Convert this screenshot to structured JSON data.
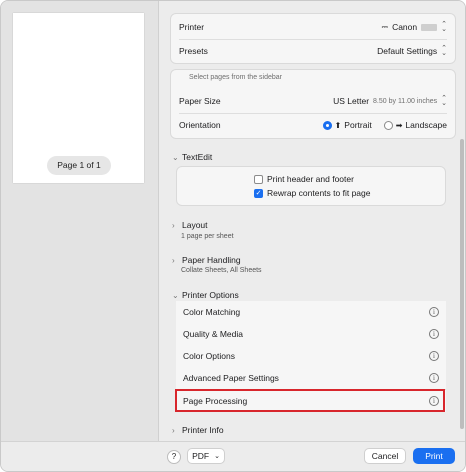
{
  "preview": {
    "page_label": "Page 1 of 1"
  },
  "printer": {
    "label": "Printer",
    "value": "Canon"
  },
  "presets": {
    "label": "Presets",
    "value": "Default Settings"
  },
  "hint": "Select pages from the sidebar",
  "paper_size": {
    "label": "Paper Size",
    "value": "US Letter",
    "detail": "8.50 by 11.00 inches"
  },
  "orientation": {
    "label": "Orientation",
    "portrait": "Portrait",
    "landscape": "Landscape",
    "selected": "Portrait"
  },
  "textedit": {
    "title": "TextEdit",
    "print_header": {
      "label": "Print header and footer",
      "checked": false
    },
    "rewrap": {
      "label": "Rewrap contents to fit page",
      "checked": true
    }
  },
  "layout": {
    "title": "Layout",
    "subtitle": "1 page per sheet"
  },
  "paper_handling": {
    "title": "Paper Handling",
    "subtitle": "Collate Sheets, All Sheets"
  },
  "printer_options": {
    "title": "Printer Options",
    "items": [
      {
        "label": "Color Matching"
      },
      {
        "label": "Quality & Media"
      },
      {
        "label": "Color Options"
      },
      {
        "label": "Advanced Paper Settings"
      },
      {
        "label": "Page Processing"
      }
    ]
  },
  "printer_info": {
    "title": "Printer Info"
  },
  "footer": {
    "help": "?",
    "pdf": "PDF",
    "cancel": "Cancel",
    "print": "Print"
  },
  "colors": {
    "accent": "#1a6ff0",
    "highlight": "#d8262c"
  }
}
